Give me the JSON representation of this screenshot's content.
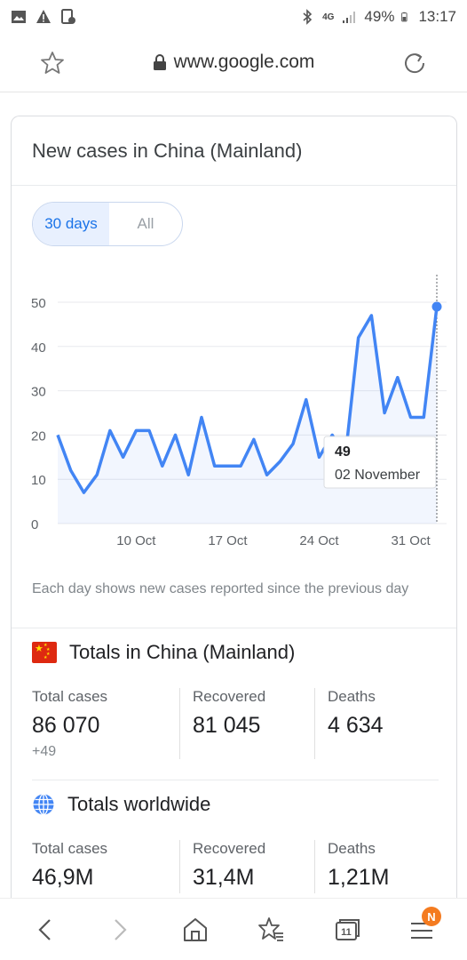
{
  "status": {
    "battery": "49%",
    "time": "13:17",
    "network": "4G"
  },
  "browser": {
    "url": "www.google.com"
  },
  "card": {
    "title": "New cases in China (Mainland)",
    "range_options": [
      "30 days",
      "All"
    ],
    "note": "Each day shows new cases reported since the previous day"
  },
  "chart_data": {
    "type": "area",
    "title": "New cases in China (Mainland)",
    "x_tick_labels": [
      "10 Oct",
      "17 Oct",
      "24 Oct",
      "31 Oct"
    ],
    "y_tick_labels": [
      "0",
      "10",
      "20",
      "30",
      "40",
      "50"
    ],
    "ylim": [
      0,
      50
    ],
    "grid": true,
    "x": [
      "04 Oct",
      "05 Oct",
      "06 Oct",
      "07 Oct",
      "08 Oct",
      "09 Oct",
      "10 Oct",
      "11 Oct",
      "12 Oct",
      "13 Oct",
      "14 Oct",
      "15 Oct",
      "16 Oct",
      "17 Oct",
      "18 Oct",
      "19 Oct",
      "20 Oct",
      "21 Oct",
      "22 Oct",
      "23 Oct",
      "24 Oct",
      "25 Oct",
      "26 Oct",
      "27 Oct",
      "28 Oct",
      "29 Oct",
      "30 Oct",
      "31 Oct",
      "01 Nov",
      "02 Nov"
    ],
    "values": [
      20,
      12,
      7,
      11,
      21,
      15,
      21,
      21,
      13,
      20,
      11,
      24,
      13,
      13,
      13,
      19,
      11,
      14,
      18,
      28,
      15,
      20,
      15,
      42,
      47,
      25,
      33,
      24,
      24,
      49
    ],
    "color": "#4285f4",
    "tooltip": {
      "value": "49",
      "date": "02 November"
    }
  },
  "china_totals": {
    "heading": "Totals in China (Mainland)",
    "stats": [
      {
        "label": "Total cases",
        "value": "86 070",
        "delta": "+49"
      },
      {
        "label": "Recovered",
        "value": "81 045"
      },
      {
        "label": "Deaths",
        "value": "4 634"
      }
    ]
  },
  "world_totals": {
    "heading": "Totals worldwide",
    "stats": [
      {
        "label": "Total cases",
        "value": "46,9M"
      },
      {
        "label": "Recovered",
        "value": "31,4M"
      },
      {
        "label": "Deaths",
        "value": "1,21M"
      }
    ]
  },
  "nav": {
    "tabs_count": "11",
    "menu_badge": "N"
  }
}
